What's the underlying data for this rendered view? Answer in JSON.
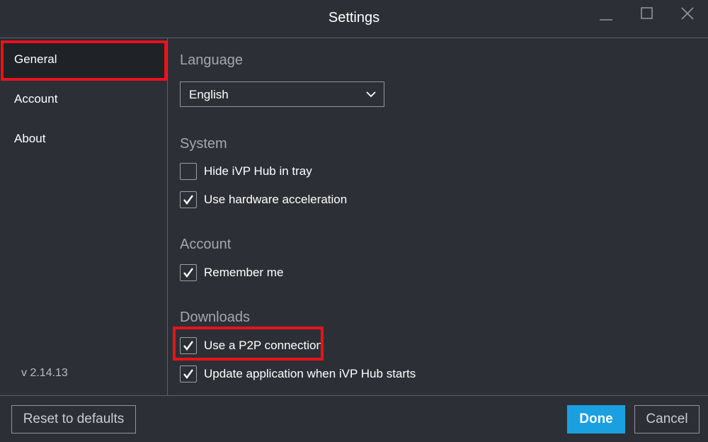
{
  "window": {
    "title": "Settings",
    "controls": {
      "minimize_icon": "minimize-icon",
      "maximize_icon": "maximize-icon",
      "close_icon": "close-icon"
    }
  },
  "sidebar": {
    "items": [
      {
        "label": "General",
        "selected": true
      },
      {
        "label": "Account",
        "selected": false
      },
      {
        "label": "About",
        "selected": false
      }
    ],
    "version": "v 2.14.13"
  },
  "sections": {
    "language": {
      "title": "Language",
      "select": {
        "value": "English",
        "icon": "chevron-down-icon"
      }
    },
    "system": {
      "title": "System",
      "options": [
        {
          "label": "Hide iVP Hub in tray",
          "checked": false
        },
        {
          "label": "Use hardware acceleration",
          "checked": true
        }
      ]
    },
    "account": {
      "title": "Account",
      "options": [
        {
          "label": "Remember me",
          "checked": true
        }
      ]
    },
    "downloads": {
      "title": "Downloads",
      "options": [
        {
          "label": "Use a P2P connection",
          "checked": true
        },
        {
          "label": "Update application when iVP Hub starts",
          "checked": true
        }
      ]
    }
  },
  "footer": {
    "reset_label": "Reset to defaults",
    "done_label": "Done",
    "cancel_label": "Cancel"
  },
  "colors": {
    "background": "#2c3036",
    "sidebar_selected": "#1f2226",
    "accent": "#1aa0e0",
    "highlight_annotation": "#e8121c",
    "section_title": "#a3a8ae"
  }
}
